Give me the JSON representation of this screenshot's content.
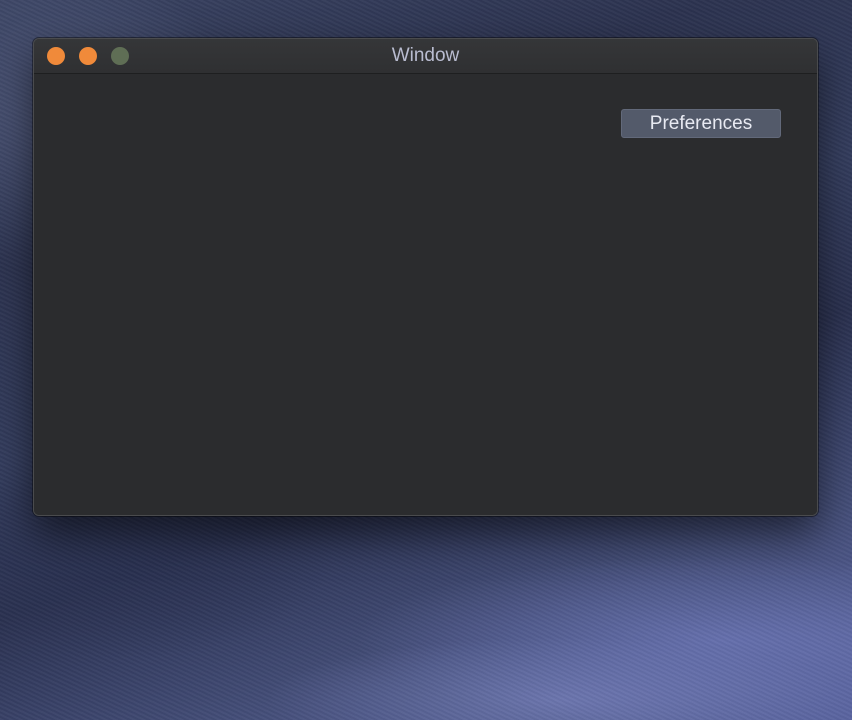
{
  "window": {
    "title": "Window",
    "traffic_lights": {
      "close": "#f08a3a",
      "minimize": "#f08a3a",
      "zoom": "#5f6e55"
    }
  },
  "content": {
    "preferences_label": "Preferences"
  }
}
